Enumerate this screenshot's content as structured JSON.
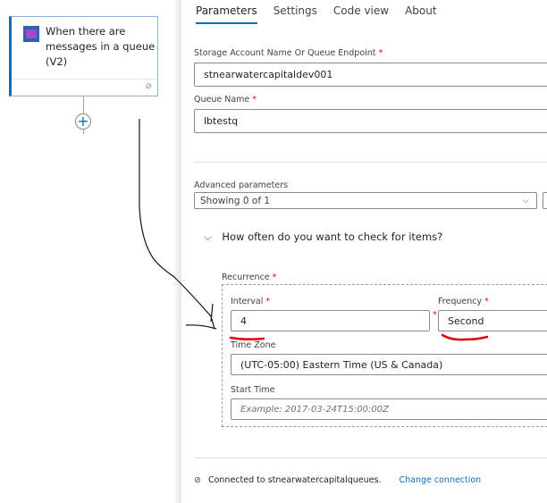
{
  "canvas": {
    "trigger_node": {
      "title": "When there are messages in a queue (V2)",
      "icon": "storage-queue-icon",
      "connection_icon": "link-icon"
    },
    "add_step_icon": "+"
  },
  "panel": {
    "tabs": [
      {
        "label": "Parameters",
        "active": true
      },
      {
        "label": "Settings",
        "active": false
      },
      {
        "label": "Code view",
        "active": false
      },
      {
        "label": "About",
        "active": false
      }
    ],
    "fields": {
      "storage_account": {
        "label": "Storage Account Name Or Queue Endpoint",
        "required": "*",
        "value": "stnearwatercapitaldev001"
      },
      "queue_name": {
        "label": "Queue Name",
        "required": "*",
        "value": "lbtestq"
      }
    },
    "advanced": {
      "label": "Advanced parameters",
      "value": "Showing 0 of 1",
      "chevron": "⌵"
    },
    "section": {
      "chevron": "⌵",
      "title": "How often do you want to check for items?"
    },
    "recurrence": {
      "label": "Recurrence",
      "required": "*",
      "interval": {
        "label": "Interval",
        "required": "*",
        "value": "4"
      },
      "frequency": {
        "label": "Frequency",
        "required": "*",
        "value": "Second"
      },
      "time_zone": {
        "label": "Time Zone",
        "value": "(UTC-05:00) Eastern Time (US & Canada)"
      },
      "start_time": {
        "label": "Start Time",
        "placeholder": "Example: 2017-03-24T15:00:00Z"
      }
    },
    "footer": {
      "connected_text": "Connected to stnearwatercapitalqueues.",
      "change_link": "Change connection",
      "icon": "⊘"
    }
  },
  "colors": {
    "accent": "#0f6cbd",
    "required": "#c50f1f",
    "annotation_red": "#e00000"
  }
}
